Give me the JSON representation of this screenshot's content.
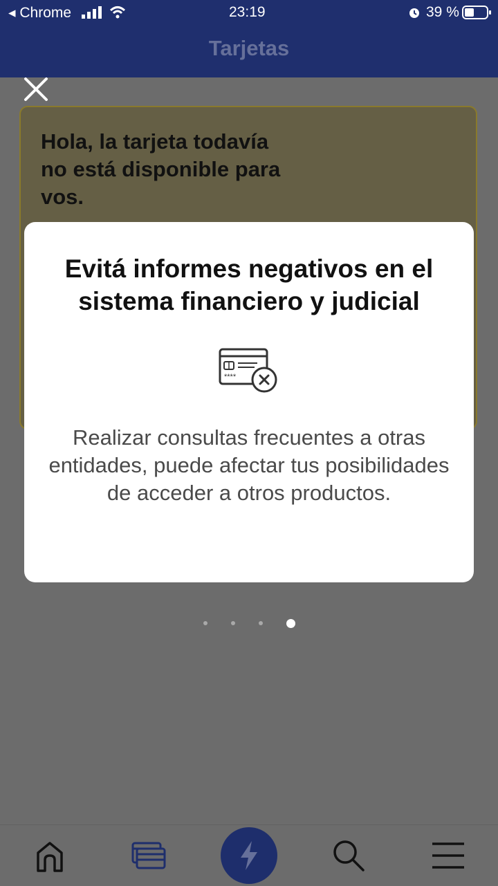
{
  "status_bar": {
    "back_app": "◂ Chrome",
    "time": "23:19",
    "battery": "39 %"
  },
  "header": {
    "title": "Tarjetas"
  },
  "notice": {
    "text": "Hola, la tarjeta todavía no está disponible para vos."
  },
  "modal": {
    "title": "Evitá informes negativos en el sistema financiero y judicial",
    "icon": "credit-card-rejected-icon",
    "body": "Realizar consultas frecuentes a otras entidades, puede afectar tus posibilidades de acceder a otros productos."
  },
  "pagination": {
    "total": 4,
    "active": 4
  },
  "tabbar": {
    "items": [
      "home-icon",
      "cards-icon",
      "lightning-icon",
      "search-icon",
      "menu-icon"
    ],
    "active": "cards-icon"
  },
  "colors": {
    "header": "#1f2f6e",
    "accent": "#1e2e6c",
    "overlay": "#6c6c6c",
    "notice_card": "#655f45"
  }
}
